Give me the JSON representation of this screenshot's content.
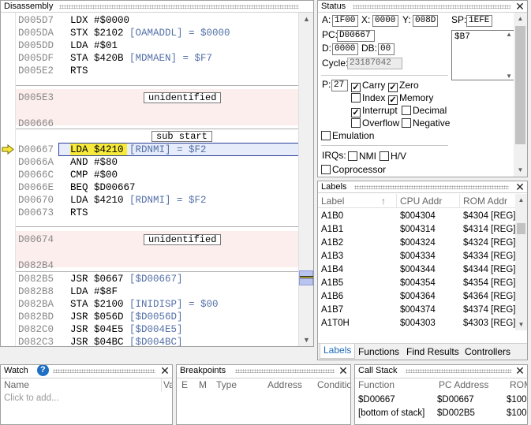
{
  "disassembly": {
    "title": "Disassembly",
    "lines": [
      {
        "addr": "D005D7",
        "code": "LDX #$0000",
        "comment": ""
      },
      {
        "addr": "D005DA",
        "code": "STX $2102 ",
        "comment": "[OAMADDL] = $0000"
      },
      {
        "addr": "D005DD",
        "code": "LDA #$01",
        "comment": ""
      },
      {
        "addr": "D005DF",
        "code": "STA $420B ",
        "comment": "[MDMAEN] = $F7"
      },
      {
        "addr": "D005E2",
        "code": "RTS",
        "comment": ""
      },
      {
        "addr": "D005E3",
        "code": "",
        "comment": ""
      },
      {
        "addr": "D00666",
        "code": "",
        "comment": ""
      },
      {
        "addr": "D00667",
        "code": "LDA $4210 ",
        "comment": "[RDNMI] = $F2"
      },
      {
        "addr": "D0066A",
        "code": "AND #$80",
        "comment": ""
      },
      {
        "addr": "D0066C",
        "code": "CMP #$00",
        "comment": ""
      },
      {
        "addr": "D0066E",
        "code": "BEQ $D00667",
        "comment": ""
      },
      {
        "addr": "D00670",
        "code": "LDA $4210 ",
        "comment": "[RDNMI] = $F2"
      },
      {
        "addr": "D00673",
        "code": "RTS",
        "comment": ""
      },
      {
        "addr": "D00674",
        "code": "",
        "comment": ""
      },
      {
        "addr": "D082B4",
        "code": "",
        "comment": ""
      },
      {
        "addr": "D082B5",
        "code": "JSR $0667 ",
        "comment": "[$D00667]"
      },
      {
        "addr": "D082B8",
        "code": "LDA #$8F",
        "comment": ""
      },
      {
        "addr": "D082BA",
        "code": "STA $2100 ",
        "comment": "[INIDISP] = $00"
      },
      {
        "addr": "D082BD",
        "code": "JSR $056D ",
        "comment": "[$D0056D]"
      },
      {
        "addr": "D082C0",
        "code": "JSR $04E5 ",
        "comment": "[$D004E5]"
      },
      {
        "addr": "D082C3",
        "code": "JSR $04BC ",
        "comment": "[$D004BC]"
      }
    ],
    "tag_unidentified_1": "unidentified",
    "tag_sub_start": "sub start",
    "tag_unidentified_2": "unidentified"
  },
  "status": {
    "title": "Status",
    "a_label": "A:",
    "a": "1F00",
    "x_label": "X:",
    "x": "0000",
    "y_label": "Y:",
    "y": "008D",
    "sp_label": "SP:",
    "sp": "1EFE",
    "pc_label": "PC:",
    "pc": "D00667",
    "d_label": "D:",
    "d": "0000",
    "db_label": "DB:",
    "db": "00",
    "cycle_label": "Cycle:",
    "cycle": "23187042",
    "stack_value": "$B7",
    "p_label": "P:",
    "p": "27",
    "flags": {
      "carry": "Carry",
      "zero": "Zero",
      "index": "Index",
      "memory": "Memory",
      "interrupt": "Interrupt",
      "decimal": "Decimal",
      "overflow": "Overflow",
      "negative": "Negative"
    },
    "emulation": "Emulation",
    "irqs_label": "IRQs:",
    "nmi": "NMI",
    "hv": "H/V",
    "coprocessor": "Coprocessor"
  },
  "labels": {
    "title": "Labels",
    "columns": [
      "Label",
      "CPU Addr",
      "ROM Addr"
    ],
    "rows": [
      [
        "A1B0",
        "$004304",
        "$4304 [REG]"
      ],
      [
        "A1B1",
        "$004314",
        "$4314 [REG]"
      ],
      [
        "A1B2",
        "$004324",
        "$4324 [REG]"
      ],
      [
        "A1B3",
        "$004334",
        "$4334 [REG]"
      ],
      [
        "A1B4",
        "$004344",
        "$4344 [REG]"
      ],
      [
        "A1B5",
        "$004354",
        "$4354 [REG]"
      ],
      [
        "A1B6",
        "$004364",
        "$4364 [REG]"
      ],
      [
        "A1B7",
        "$004374",
        "$4374 [REG]"
      ],
      [
        "A1T0H",
        "$004303",
        "$4303 [REG]"
      ]
    ],
    "tabs": [
      "Labels",
      "Functions",
      "Find Results",
      "Controllers"
    ]
  },
  "watch": {
    "title": "Watch",
    "columns": [
      "Name",
      "Va"
    ],
    "placeholder": "Click to add..."
  },
  "breakpoints": {
    "title": "Breakpoints",
    "columns": [
      "E",
      "M",
      "Type",
      "Address",
      "Conditio"
    ]
  },
  "callstack": {
    "title": "Call Stack",
    "columns": [
      "Function",
      "PC Address",
      "ROM"
    ],
    "rows": [
      [
        "$D00667",
        "$D00667",
        "$100"
      ],
      [
        "[bottom of stack]",
        "$D002B5",
        "$100"
      ]
    ]
  }
}
